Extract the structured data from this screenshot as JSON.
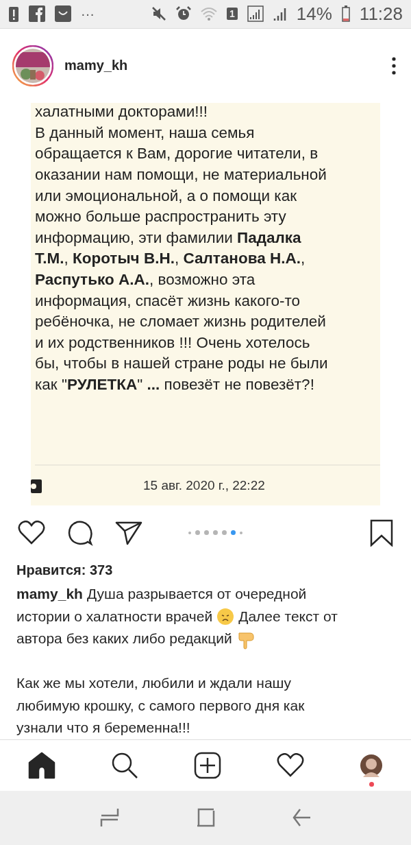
{
  "status_bar": {
    "overflow": "···",
    "sim": "1",
    "battery": "14%",
    "time": "11:28"
  },
  "post": {
    "username": "mamy_kh",
    "document": {
      "lines": [
        "халатными докторами!!!",
        "В данный момент, наша семья",
        "обращается к Вам, дорогие читатели, в",
        "оказании нам помощи, не материальной",
        "или эмоциональной, а о помощи как",
        "можно больше распространить эту",
        "информацию, эти фамилии **Падалка**",
        "**Т.М.**, **Коротыч В.Н.**, **Салтанова Н.А.**,",
        "**Распутько А.А.**, возможно эта",
        "информация, спасёт жизнь какого-то",
        "ребёночка, не сломает жизнь родителей",
        "и их родственников !!! Очень хотелось",
        "бы, чтобы в нашей стране роды не были",
        "как \"**РУЛЕТКА**\" **...** повезёт не повезёт?!"
      ],
      "date": "15 авг. 2020 г., 22:22"
    },
    "carousel_dots": [
      {
        "selected": false
      },
      {
        "selected": false
      },
      {
        "selected": false
      },
      {
        "selected": false
      },
      {
        "selected": false
      },
      {
        "selected": true
      },
      {
        "selected": false
      }
    ],
    "likes": "Нравится: 373",
    "caption": {
      "username": "mamy_kh",
      "paragraphs": [
        {
          "lines": [
            [
              {
                "kind": "text",
                "text": "Душа разрывается от очередной"
              }
            ],
            [
              {
                "kind": "text",
                "text": "истории о халатности врачей"
              },
              {
                "kind": "sad_face"
              },
              {
                "kind": "text",
                "text": "Далее текст от"
              }
            ],
            [
              {
                "kind": "text",
                "text": "автора без каких либо редакций"
              },
              {
                "kind": "pointing_down"
              }
            ]
          ]
        },
        {
          "lines": [
            [
              {
                "kind": "text",
                "text": "Как же мы хотели, любили и ждали нашу"
              }
            ],
            [
              {
                "kind": "text",
                "text": "любимую крошку, с самого первого дня как"
              }
            ],
            [
              {
                "kind": "text",
                "text": "узнали что я беременна!!!"
              }
            ]
          ]
        }
      ]
    }
  },
  "bottom_nav": [
    {
      "kind": "home",
      "selected": true
    },
    {
      "kind": "search",
      "selected": false
    },
    {
      "kind": "add",
      "selected": false
    },
    {
      "kind": "activity",
      "selected": false
    },
    {
      "kind": "profile",
      "selected": false,
      "badge": true
    }
  ]
}
